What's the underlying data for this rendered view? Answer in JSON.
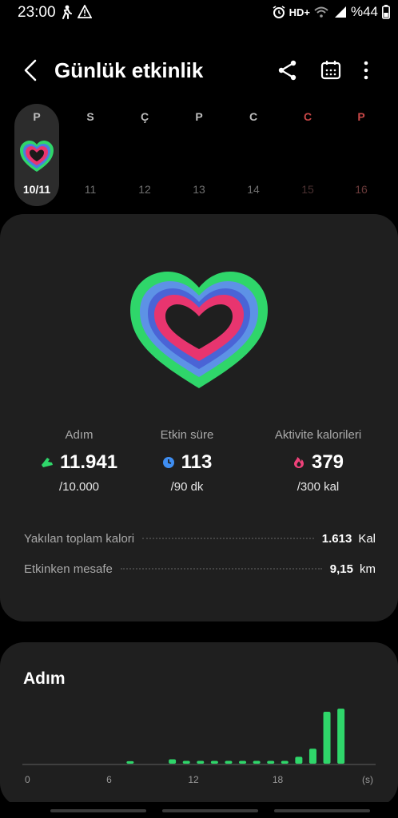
{
  "status_bar": {
    "time": "23:00",
    "network": "HD+",
    "battery": "%44",
    "icons": [
      "walk-notification-icon",
      "warning-icon",
      "alarm-icon",
      "wifi-icon",
      "signal-icon",
      "battery-icon"
    ]
  },
  "header": {
    "title": "Günlük etkinlik",
    "actions": [
      "back-icon",
      "share-icon",
      "calendar-icon",
      "more-icon"
    ]
  },
  "week": {
    "days": [
      {
        "dow": "P",
        "date": "10/11",
        "selected": true,
        "kind": "weekday"
      },
      {
        "dow": "S",
        "date": "11",
        "selected": false,
        "kind": "weekday"
      },
      {
        "dow": "Ç",
        "date": "12",
        "selected": false,
        "kind": "weekday"
      },
      {
        "dow": "P",
        "date": "13",
        "selected": false,
        "kind": "weekday"
      },
      {
        "dow": "C",
        "date": "14",
        "selected": false,
        "kind": "weekday"
      },
      {
        "dow": "C",
        "date": "15",
        "selected": false,
        "kind": "saturday"
      },
      {
        "dow": "P",
        "date": "16",
        "selected": false,
        "kind": "sunday"
      }
    ]
  },
  "summary": {
    "metrics": [
      {
        "label": "Adım",
        "value": "11.941",
        "goal": "/10.000",
        "icon": "shoe-icon",
        "color": "#2fd66a"
      },
      {
        "label": "Etkin süre",
        "value": "113",
        "goal": "/90 dk",
        "icon": "clock-icon",
        "color": "#3f8ef2"
      },
      {
        "label": "Aktivite kalorileri",
        "value": "379",
        "goal": "/300 kal",
        "icon": "flame-icon",
        "color": "#f0427a"
      }
    ],
    "stats": [
      {
        "name": "Yakılan toplam kalori",
        "value": "1.613",
        "unit": "Kal"
      },
      {
        "name": "Etkinken mesafe",
        "value": "9,15",
        "unit": "km"
      }
    ],
    "ring_colors": {
      "steps": "#2fd66a",
      "active_time": "#4a7de0",
      "calories": "#e8356f"
    }
  },
  "steps_section": {
    "title": "Adım"
  },
  "chart_data": {
    "type": "bar",
    "title": "Adım",
    "xlabel": "(s)",
    "ylabel": "",
    "x_ticks": [
      "0",
      "6",
      "12",
      "18",
      "(s)"
    ],
    "xlim": [
      0,
      24
    ],
    "ylim": [
      0,
      2400
    ],
    "x": [
      7,
      10,
      11,
      12,
      13,
      14,
      15,
      16,
      17,
      18,
      19,
      20,
      21,
      22
    ],
    "values": [
      80,
      140,
      90,
      90,
      90,
      90,
      90,
      90,
      90,
      90,
      220,
      480,
      1660,
      1760
    ],
    "color": "#2fd66a",
    "grid": false
  }
}
